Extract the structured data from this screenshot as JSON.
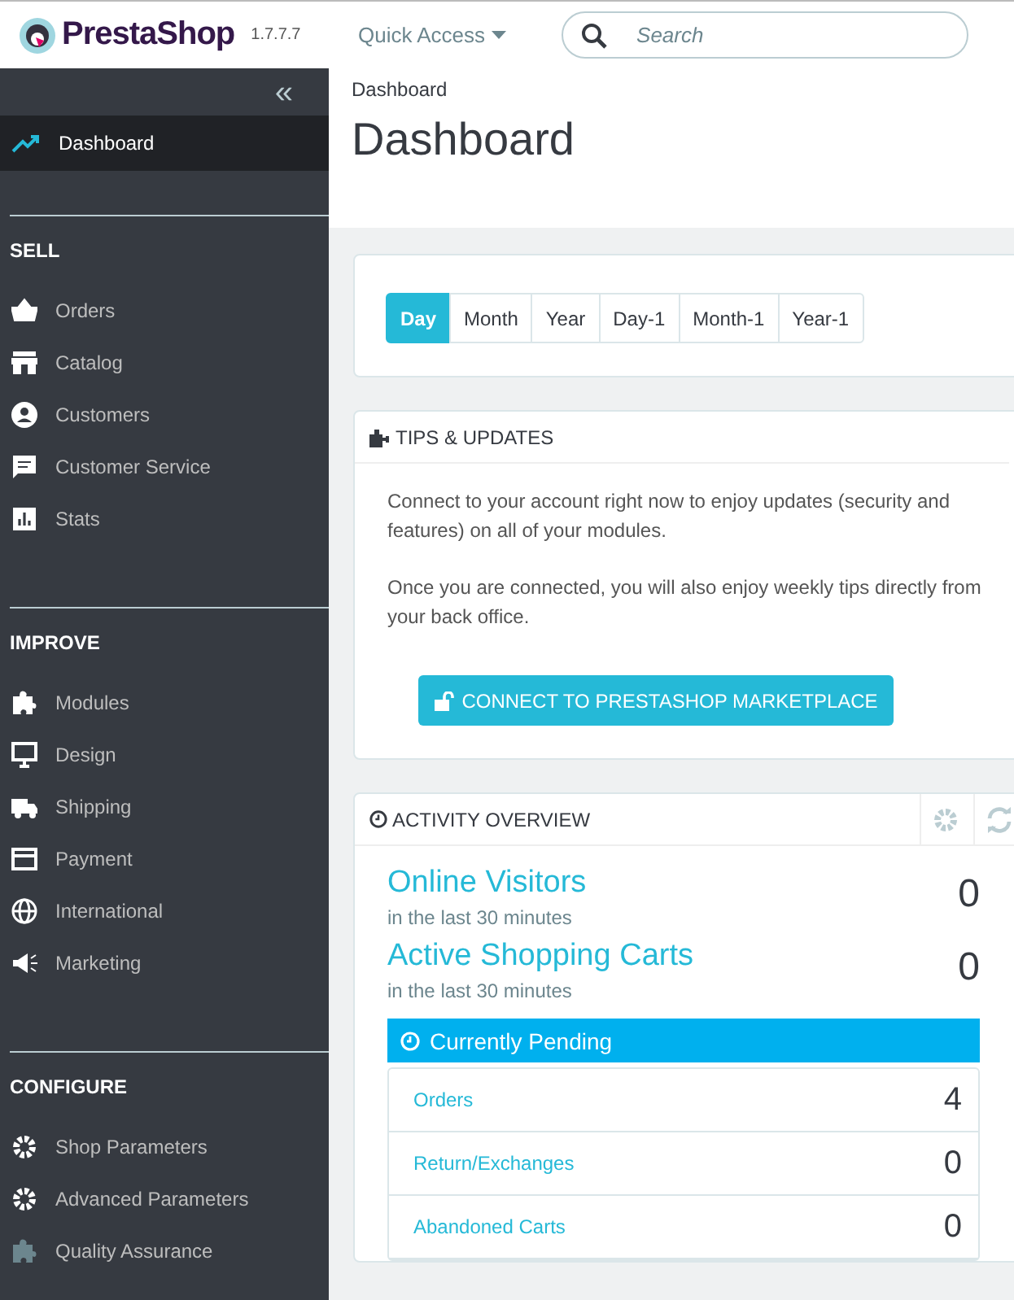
{
  "header": {
    "logo": "PrestaShop",
    "version": "1.7.7.7",
    "quick_access": "Quick Access",
    "search": {
      "placeholder": "Search"
    }
  },
  "sidebar": {
    "collapse": "«",
    "items": [
      {
        "label": "Dashboard",
        "selected": true
      }
    ],
    "sections": [
      {
        "title": "SELL",
        "items": [
          {
            "label": "Orders",
            "selected": false
          },
          {
            "label": "Catalog",
            "selected": false
          },
          {
            "label": "Customers",
            "selected": false
          },
          {
            "label": "Customer Service",
            "selected": false
          },
          {
            "label": "Stats",
            "selected": false
          }
        ]
      },
      {
        "title": "IMPROVE",
        "items": [
          {
            "label": "Modules",
            "selected": false
          },
          {
            "label": "Design",
            "selected": false
          },
          {
            "label": "Shipping",
            "selected": false
          },
          {
            "label": "Payment",
            "selected": false
          },
          {
            "label": "International",
            "selected": false
          },
          {
            "label": "Marketing",
            "selected": false
          }
        ]
      },
      {
        "title": "CONFIGURE",
        "items": [
          {
            "label": "Shop Parameters",
            "selected": false
          },
          {
            "label": "Advanced Parameters",
            "selected": false
          },
          {
            "label": "Quality Assurance",
            "selected": false
          }
        ]
      }
    ]
  },
  "breadcrumb": "Dashboard",
  "page_title": "Dashboard",
  "periods": [
    {
      "label": "Day",
      "selected": true
    },
    {
      "label": "Month",
      "selected": false
    },
    {
      "label": "Year",
      "selected": false
    },
    {
      "label": "Day-1",
      "selected": false
    },
    {
      "label": "Month-1",
      "selected": false
    },
    {
      "label": "Year-1",
      "selected": false
    }
  ],
  "tips": {
    "title": "TIPS & UPDATES",
    "paragraphs": [
      "Connect to your account right now to enjoy updates (security and features) on all of your modules.",
      "Once you are connected, you will also enjoy weekly tips directly from your back office."
    ],
    "button": "CONNECT TO PRESTASHOP MARKETPLACE"
  },
  "activity": {
    "title": "ACTIVITY OVERVIEW",
    "metrics": [
      {
        "label": "Online Visitors",
        "sub": "in the last 30 minutes",
        "value": "0"
      },
      {
        "label": "Active Shopping Carts",
        "sub": "in the last 30 minutes",
        "value": "0"
      }
    ],
    "pending": {
      "title": "Currently Pending",
      "rows": [
        {
          "label": "Orders",
          "value": "4"
        },
        {
          "label": "Return/Exchanges",
          "value": "0"
        },
        {
          "label": "Abandoned Carts",
          "value": "0"
        }
      ]
    }
  }
}
